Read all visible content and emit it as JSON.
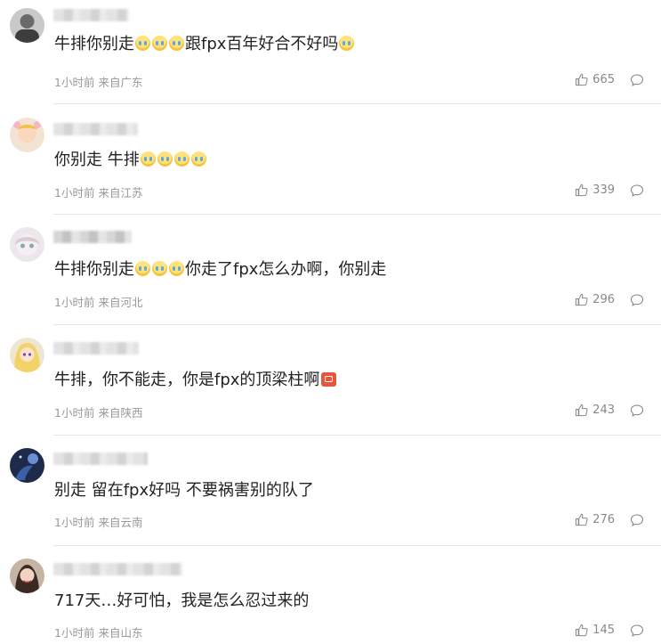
{
  "comments": [
    {
      "segments": [
        "牛排你别走",
        "跟fpx百年好合不好吗"
      ],
      "emojis_after_segment_1": 3,
      "trailing_emoji": "crying",
      "time": "1小时前",
      "location": "来自广东",
      "likes": "665"
    },
    {
      "segments": [
        "你别走 牛排"
      ],
      "emojis_after_segment_1": 4,
      "time": "1小时前",
      "location": "来自江苏",
      "likes": "339"
    },
    {
      "segments": [
        "牛排你别走",
        "你走了fpx怎么办啊，你别走"
      ],
      "emojis_after_segment_1": 3,
      "time": "1小时前",
      "location": "来自河北",
      "likes": "296"
    },
    {
      "segments": [
        "牛排，你不能走，你是fpx的顶梁柱啊"
      ],
      "trailing_emoji": "angry",
      "time": "1小时前",
      "location": "来自陕西",
      "likes": "243"
    },
    {
      "segments": [
        "别走 留在fpx好吗 不要祸害别的队了"
      ],
      "time": "1小时前",
      "location": "来自云南",
      "likes": "276"
    },
    {
      "segments": [
        "717天…好可怕，我是怎么忍过来的"
      ],
      "time": "1小时前",
      "location": "来自山东",
      "likes": "145"
    }
  ],
  "icons": {
    "like": "thumbs-up-icon",
    "reply": "comment-bubble-icon",
    "emoji_cry": "crying-face-emoji",
    "emoji_angry": "angry-emoji"
  },
  "colors": {
    "meta_text": "#999999",
    "divider": "#e6e6e6",
    "body_text": "#222222"
  }
}
